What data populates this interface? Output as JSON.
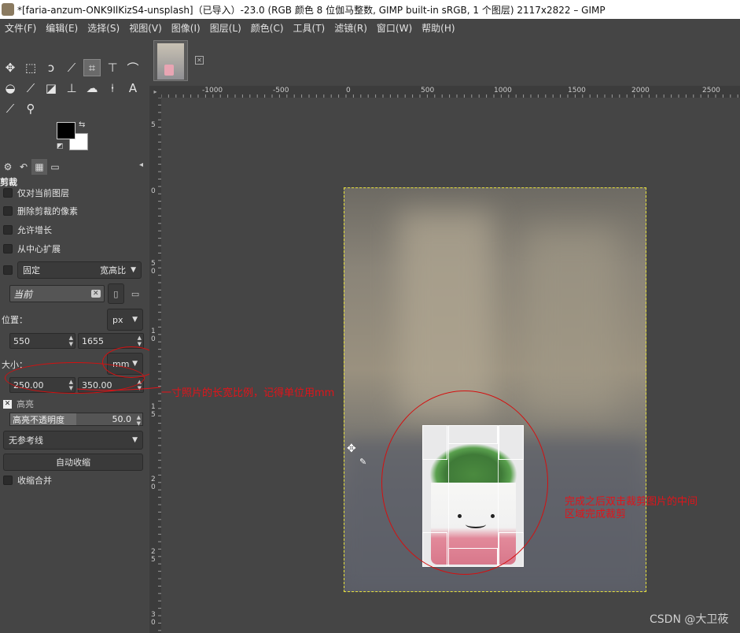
{
  "window": {
    "title": "*[faria-anzum-ONK9IlKizS4-unsplash]（已导入）-23.0 (RGB 颜色 8 位伽马整数, GIMP built-in sRGB, 1 个图层) 2117x2822 – GIMP"
  },
  "menu": [
    "文件(F)",
    "编辑(E)",
    "选择(S)",
    "视图(V)",
    "图像(I)",
    "图层(L)",
    "颜色(C)",
    "工具(T)",
    "滤镜(R)",
    "窗口(W)",
    "帮助(H)"
  ],
  "tools": {
    "row1": [
      "move-tool-icon",
      "rect-select-icon",
      "lasso-icon",
      "fuzzy-select-icon",
      "crop-tool-icon",
      "transform-icon",
      "warp-icon"
    ],
    "row2": [
      "bucket-fill-icon",
      "paintbrush-icon",
      "eraser-icon",
      "clone-icon",
      "smudge-icon",
      "path-icon",
      "text-tool-icon"
    ],
    "row3": [
      "color-picker-icon",
      "zoom-icon"
    ],
    "text_glyph": "A"
  },
  "tool_options": {
    "title": "剪裁",
    "current_layer_only": "仅对当前图层",
    "delete_cropped": "删除剪裁的像素",
    "allow_growing": "允许增长",
    "expand_from_center": "从中心扩展",
    "fixed_label": "固定",
    "fixed_mode": "宽高比",
    "current_entry": "当前",
    "position_label": "位置：",
    "position_unit": "px",
    "position_x": "550",
    "position_y": "1655",
    "size_label": "大小：",
    "size_unit": "mm",
    "size_w": "250.00",
    "size_h": "350.00",
    "highlight_label": "高亮",
    "highlight_opacity_label": "高亮不透明度",
    "highlight_opacity_value": "50.0",
    "highlight_opacity_fraction": 0.5,
    "guides": "无参考线",
    "auto_shrink": "自动收缩",
    "shrink_merged": "收缩合并"
  },
  "rulers": {
    "h_ticks": [
      "-1000",
      "-500",
      "0",
      "500",
      "1000",
      "1500",
      "2000",
      "2500"
    ],
    "v_ticks": [
      "5",
      "0",
      "5",
      "0",
      "1",
      "0",
      "1",
      "5",
      "2",
      "0",
      "2",
      "5",
      "3",
      "0"
    ]
  },
  "annotations": {
    "size_note": "一寸照片的长宽比例，记得单位用mm",
    "crop_note_line1": "完成之后双击裁剪图片的中间",
    "crop_note_line2": "区域完成裁剪"
  },
  "watermark": "CSDN @大卫莜",
  "colors": {
    "annotation_red": "#e0141a",
    "selection_dash": "#e8e23a"
  }
}
